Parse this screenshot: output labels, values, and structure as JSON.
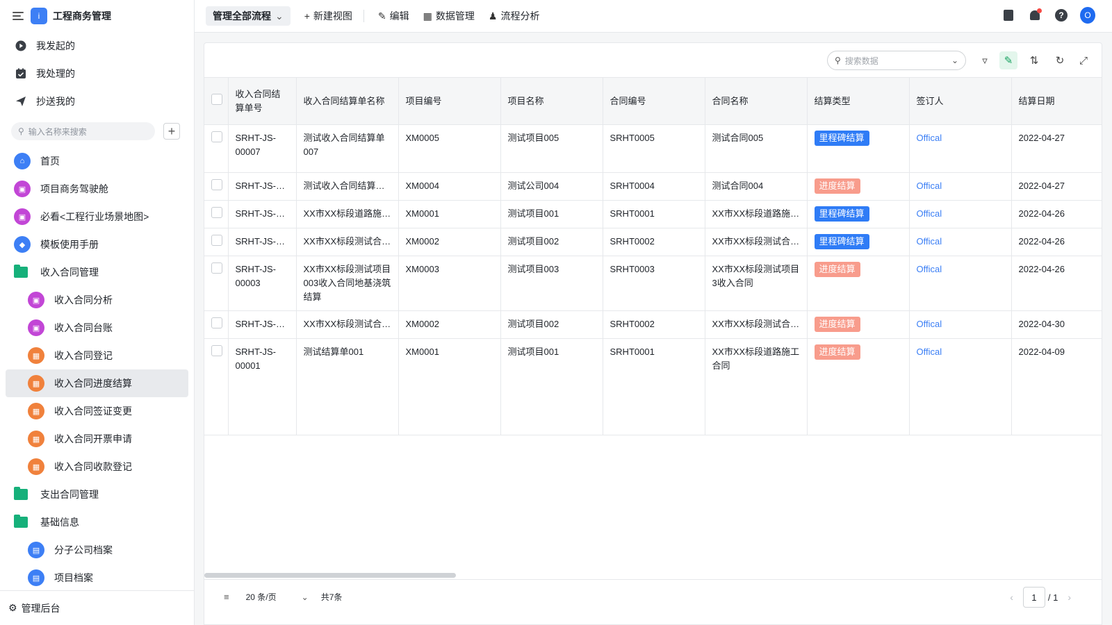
{
  "app": {
    "title": "工程商务管理",
    "logo_text": "i"
  },
  "quick": [
    {
      "label": "我发起的",
      "icon": "play-circle-icon"
    },
    {
      "label": "我处理的",
      "icon": "check-square-icon"
    },
    {
      "label": "抄送我的",
      "icon": "send-icon"
    }
  ],
  "sidebar_search": {
    "placeholder": "输入名称来搜索"
  },
  "nav": [
    {
      "label": "首页"
    },
    {
      "label": "项目商务驾驶舱"
    },
    {
      "label": "必看<工程行业场景地图>"
    },
    {
      "label": "模板使用手册"
    },
    {
      "label": "收入合同管理"
    },
    {
      "label": "收入合同分析"
    },
    {
      "label": "收入合同台账"
    },
    {
      "label": "收入合同登记"
    },
    {
      "label": "收入合同进度结算"
    },
    {
      "label": "收入合同签证变更"
    },
    {
      "label": "收入合同开票申请"
    },
    {
      "label": "收入合同收款登记"
    },
    {
      "label": "支出合同管理"
    },
    {
      "label": "基础信息"
    },
    {
      "label": "分子公司档案"
    },
    {
      "label": "项目档案"
    }
  ],
  "sidebar_footer": {
    "label": "管理后台"
  },
  "topbar": {
    "view_select": "管理全部流程",
    "new_view": "新建视图",
    "edit": "编辑",
    "data_manage": "数据管理",
    "flow_analysis": "流程分析",
    "avatar": "O"
  },
  "toolbar": {
    "search_placeholder": "搜索数据"
  },
  "table": {
    "headers": [
      "收入合同结算单号",
      "收入合同结算单名称",
      "项目编号",
      "项目名称",
      "合同编号",
      "合同名称",
      "结算类型",
      "签订人",
      "结算日期"
    ],
    "rows": [
      {
        "no": "SRHT-JS-00007",
        "name": "测试收入合同结算单007",
        "proj_no": "XM0005",
        "proj_name": "测试项目005",
        "contract_no": "SRHT0005",
        "contract_name": "测试合同005",
        "type": "里程碑结算",
        "signer": "Offical",
        "date": "2022-04-27"
      },
      {
        "no": "SRHT-JS-0…",
        "name": "测试收入合同结算…",
        "proj_no": "XM0004",
        "proj_name": "测试公司004",
        "contract_no": "SRHT0004",
        "contract_name": "测试合同004",
        "type": "进度结算",
        "signer": "Offical",
        "date": "2022-04-27"
      },
      {
        "no": "SRHT-JS-0…",
        "name": "XX市XX标段道路施…",
        "proj_no": "XM0001",
        "proj_name": "测试项目001",
        "contract_no": "SRHT0001",
        "contract_name": "XX市XX标段道路施…",
        "type": "里程碑结算",
        "signer": "Offical",
        "date": "2022-04-26"
      },
      {
        "no": "SRHT-JS-0…",
        "name": "XX市XX标段测试合…",
        "proj_no": "XM0002",
        "proj_name": "测试项目002",
        "contract_no": "SRHT0002",
        "contract_name": "XX市XX标段测试合…",
        "type": "里程碑结算",
        "signer": "Offical",
        "date": "2022-04-26"
      },
      {
        "no": "SRHT-JS-00003",
        "name": "XX市XX标段测试项目003收入合同地基浇筑结算",
        "proj_no": "XM0003",
        "proj_name": "测试项目003",
        "contract_no": "SRHT0003",
        "contract_name": "XX市XX标段测试项目3收入合同",
        "type": "进度结算",
        "signer": "Offical",
        "date": "2022-04-26"
      },
      {
        "no": "SRHT-JS-0…",
        "name": "XX市XX标段测试合…",
        "proj_no": "XM0002",
        "proj_name": "测试项目002",
        "contract_no": "SRHT0002",
        "contract_name": "XX市XX标段测试合…",
        "type": "进度结算",
        "signer": "Offical",
        "date": "2022-04-30"
      },
      {
        "no": "SRHT-JS-00001",
        "name": "测试结算单001",
        "proj_no": "XM0001",
        "proj_name": "测试项目001",
        "contract_no": "SRHT0001",
        "contract_name": "XX市XX标段道路施工合同",
        "type": "进度结算",
        "signer": "Offical",
        "date": "2022-04-09"
      }
    ]
  },
  "pagination": {
    "page_size": "20 条/页",
    "total": "共7条",
    "current": "1",
    "of_total": "/ 1"
  },
  "colors": {
    "accent": "#3d7ff5",
    "milestone_tag": "#2f7cf6",
    "progress_tag": "#f89c8c",
    "link": "#3a7ef5"
  }
}
